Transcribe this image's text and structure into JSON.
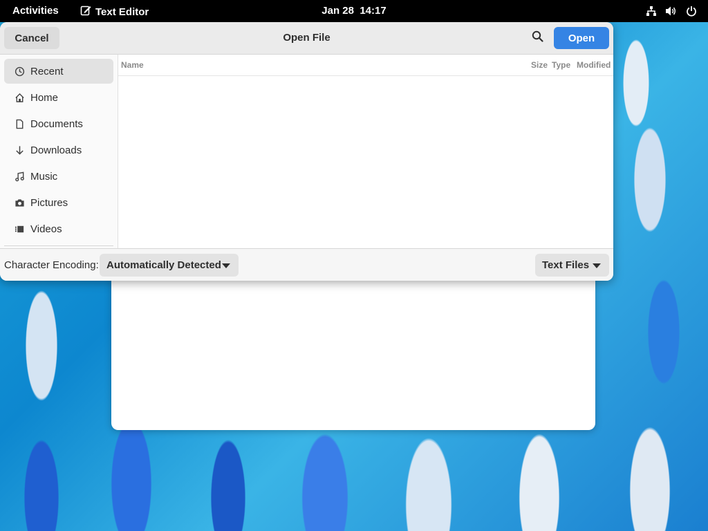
{
  "topbar": {
    "activities": "Activities",
    "app_name": "Text Editor",
    "app_icon": "text-editor-icon",
    "date": "Jan 28",
    "time": "14:17",
    "tray_icons": [
      "network-icon",
      "volume-icon",
      "power-icon"
    ]
  },
  "dialog": {
    "title": "Open File",
    "cancel_label": "Cancel",
    "open_label": "Open",
    "search_icon": "search-icon"
  },
  "sidebar": {
    "items": [
      {
        "label": "Recent",
        "icon": "clock-icon",
        "active": true
      },
      {
        "label": "Home",
        "icon": "home-icon"
      },
      {
        "label": "Documents",
        "icon": "document-icon"
      },
      {
        "label": "Downloads",
        "icon": "download-icon"
      },
      {
        "label": "Music",
        "icon": "music-icon"
      },
      {
        "label": "Pictures",
        "icon": "camera-icon"
      },
      {
        "label": "Videos",
        "icon": "video-icon"
      }
    ]
  },
  "filelist": {
    "columns": [
      "Name",
      "Size",
      "Type",
      "Modified"
    ]
  },
  "footer": {
    "encoding_label": "Character Encoding:",
    "encoding_value": "Automatically Detected",
    "filter_value": "Text Files"
  },
  "colors": {
    "accent": "#3584e4",
    "topbar": "#000000",
    "header": "#ebebeb"
  }
}
